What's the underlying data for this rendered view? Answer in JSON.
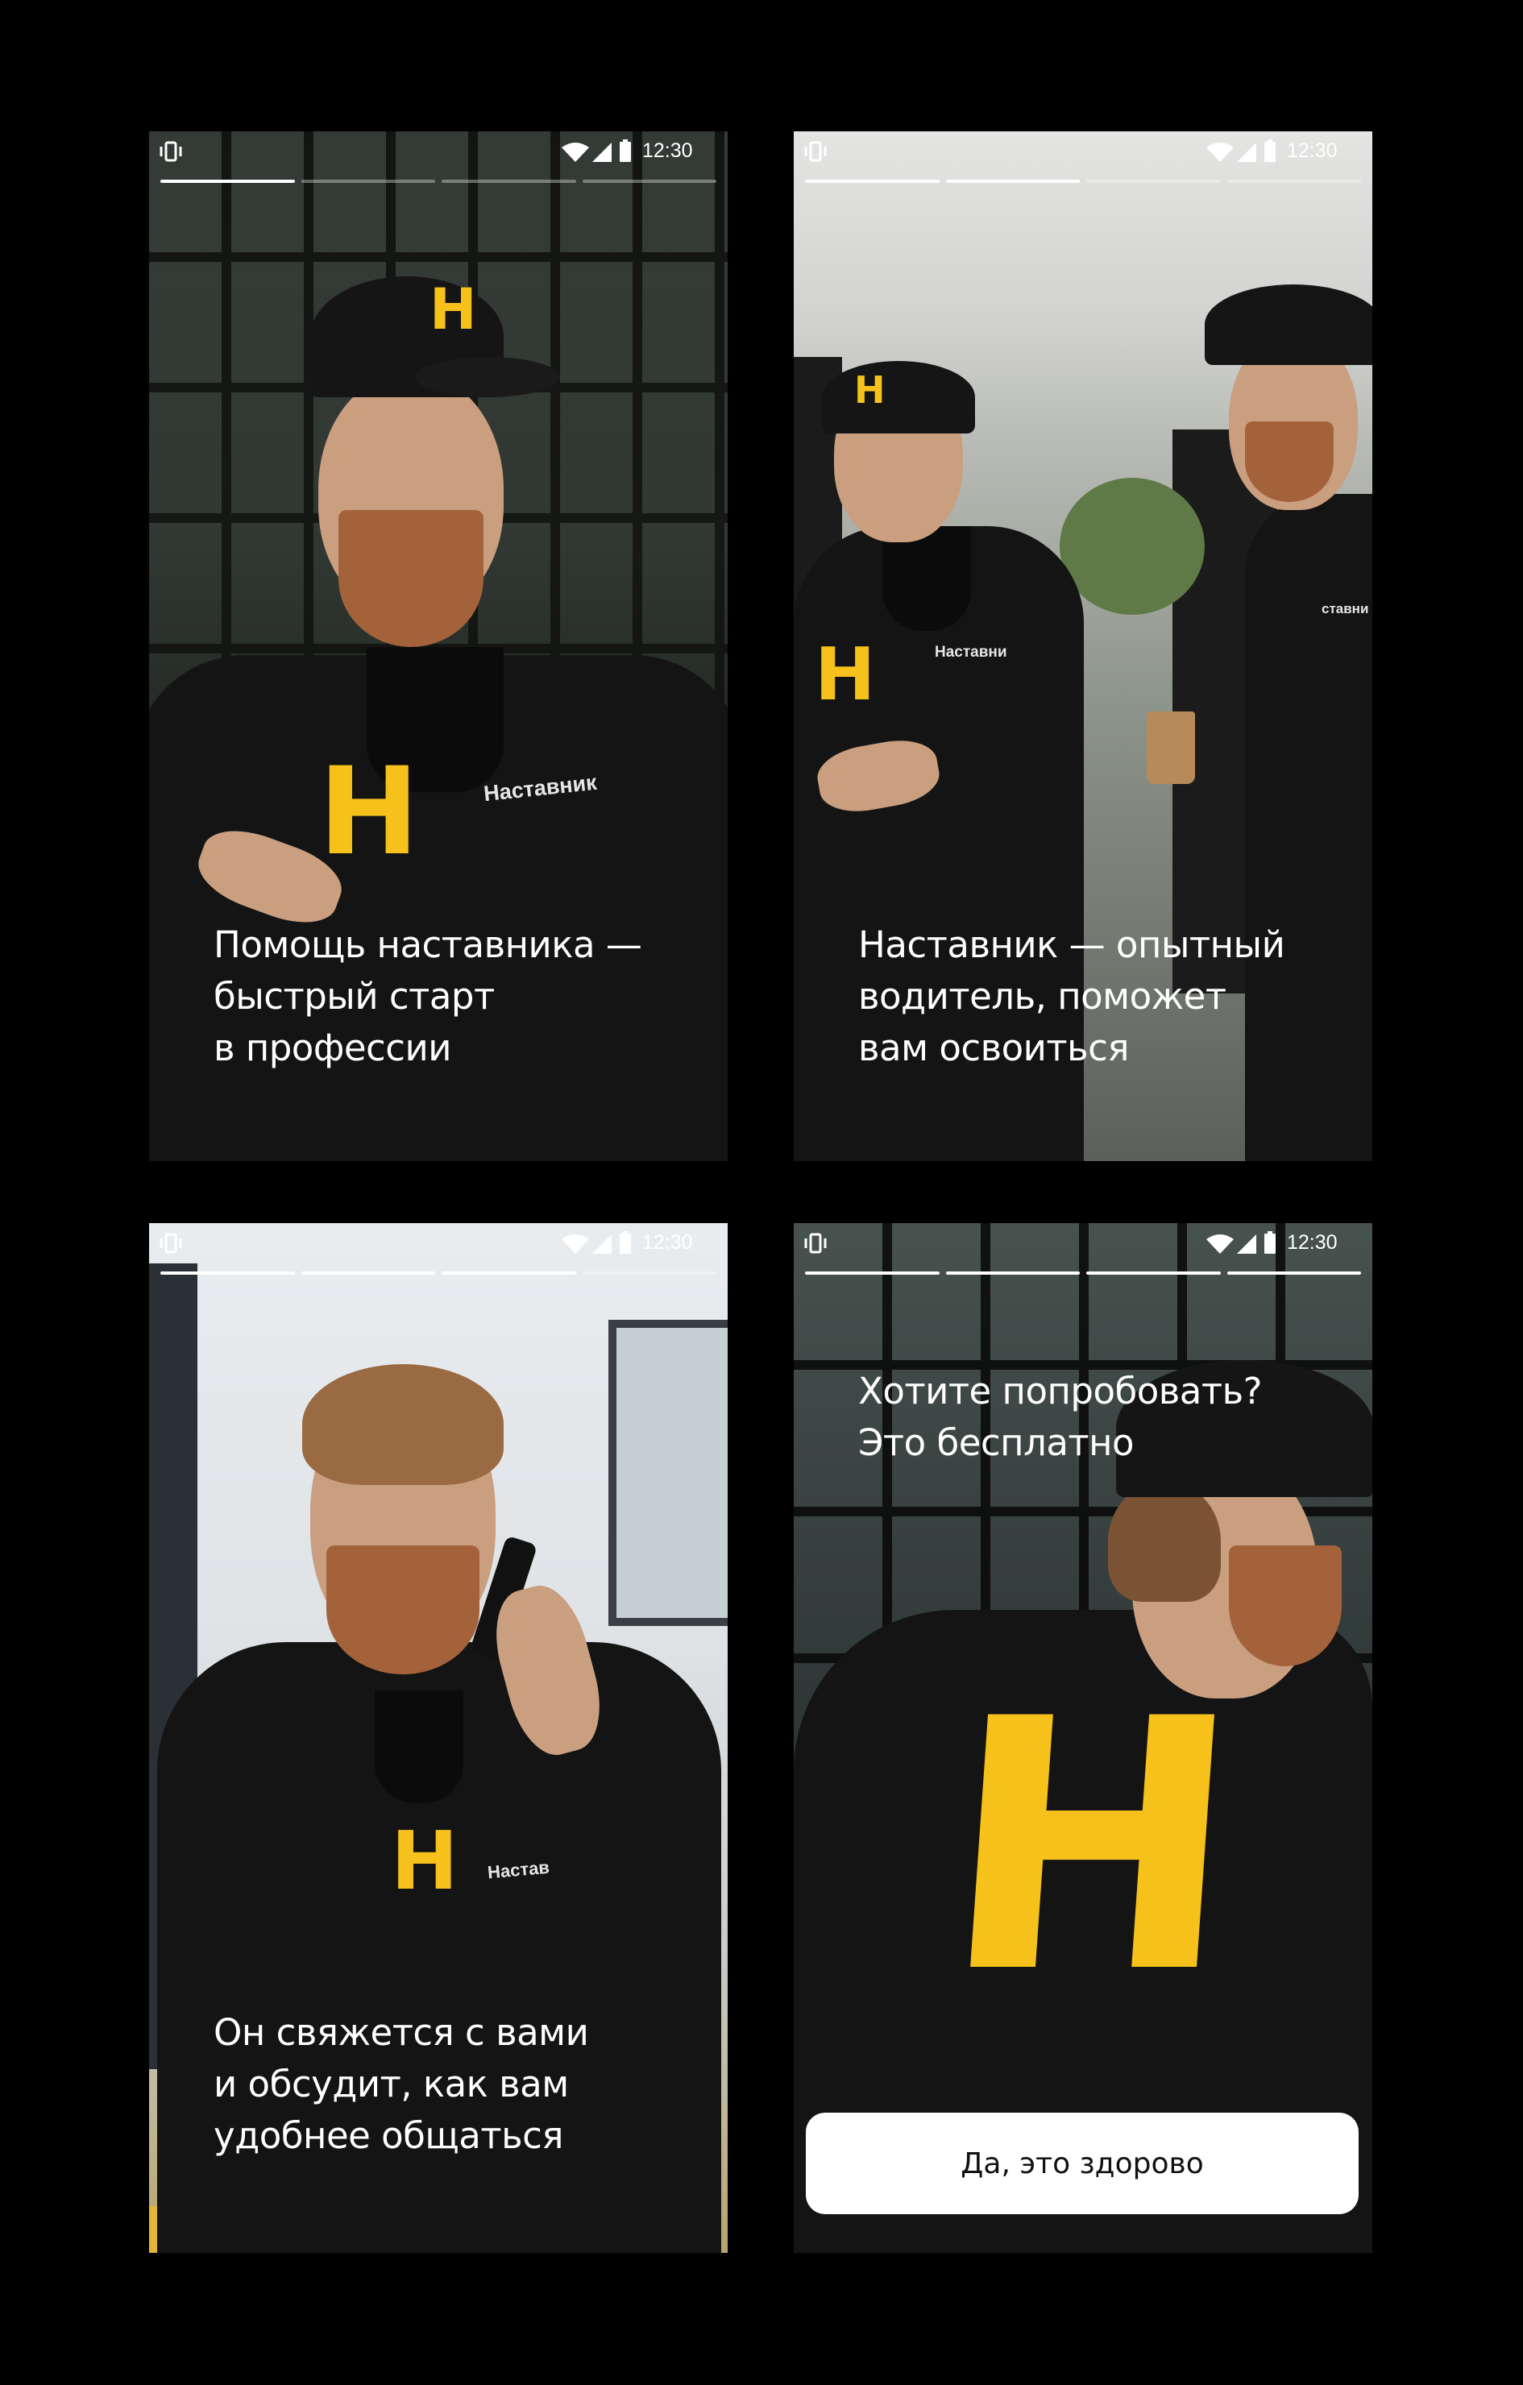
{
  "status_bar": {
    "time": "12:30"
  },
  "story_total_segments": 4,
  "screens": [
    {
      "active_segments": 1,
      "caption": "Помощь наставника —\nбыстрый старт\nв профессии",
      "jacket_logo": "H",
      "chest_text": "Наставник"
    },
    {
      "active_segments": 2,
      "caption": "Наставник — опытный\nводитель, поможет\nвам освоиться",
      "jacket_logo": "H",
      "chest_text": "Наставни",
      "chest_text_right": "ставни"
    },
    {
      "active_segments": 3,
      "caption": "Он свяжется с вами\nи обсудит, как вам\nудобнее общаться",
      "jacket_logo": "H",
      "chest_text": "Настав"
    },
    {
      "active_segments": 4,
      "caption": "Хотите попробовать?\nЭто бесплатно",
      "jacket_logo": "H",
      "cta_label": "Да, это здорово"
    }
  ],
  "colors": {
    "accent_yellow": "#f6c11a",
    "button_bg": "#ffffff"
  },
  "icons": [
    "vibrate-icon",
    "wifi-icon",
    "signal-icon",
    "battery-icon"
  ]
}
